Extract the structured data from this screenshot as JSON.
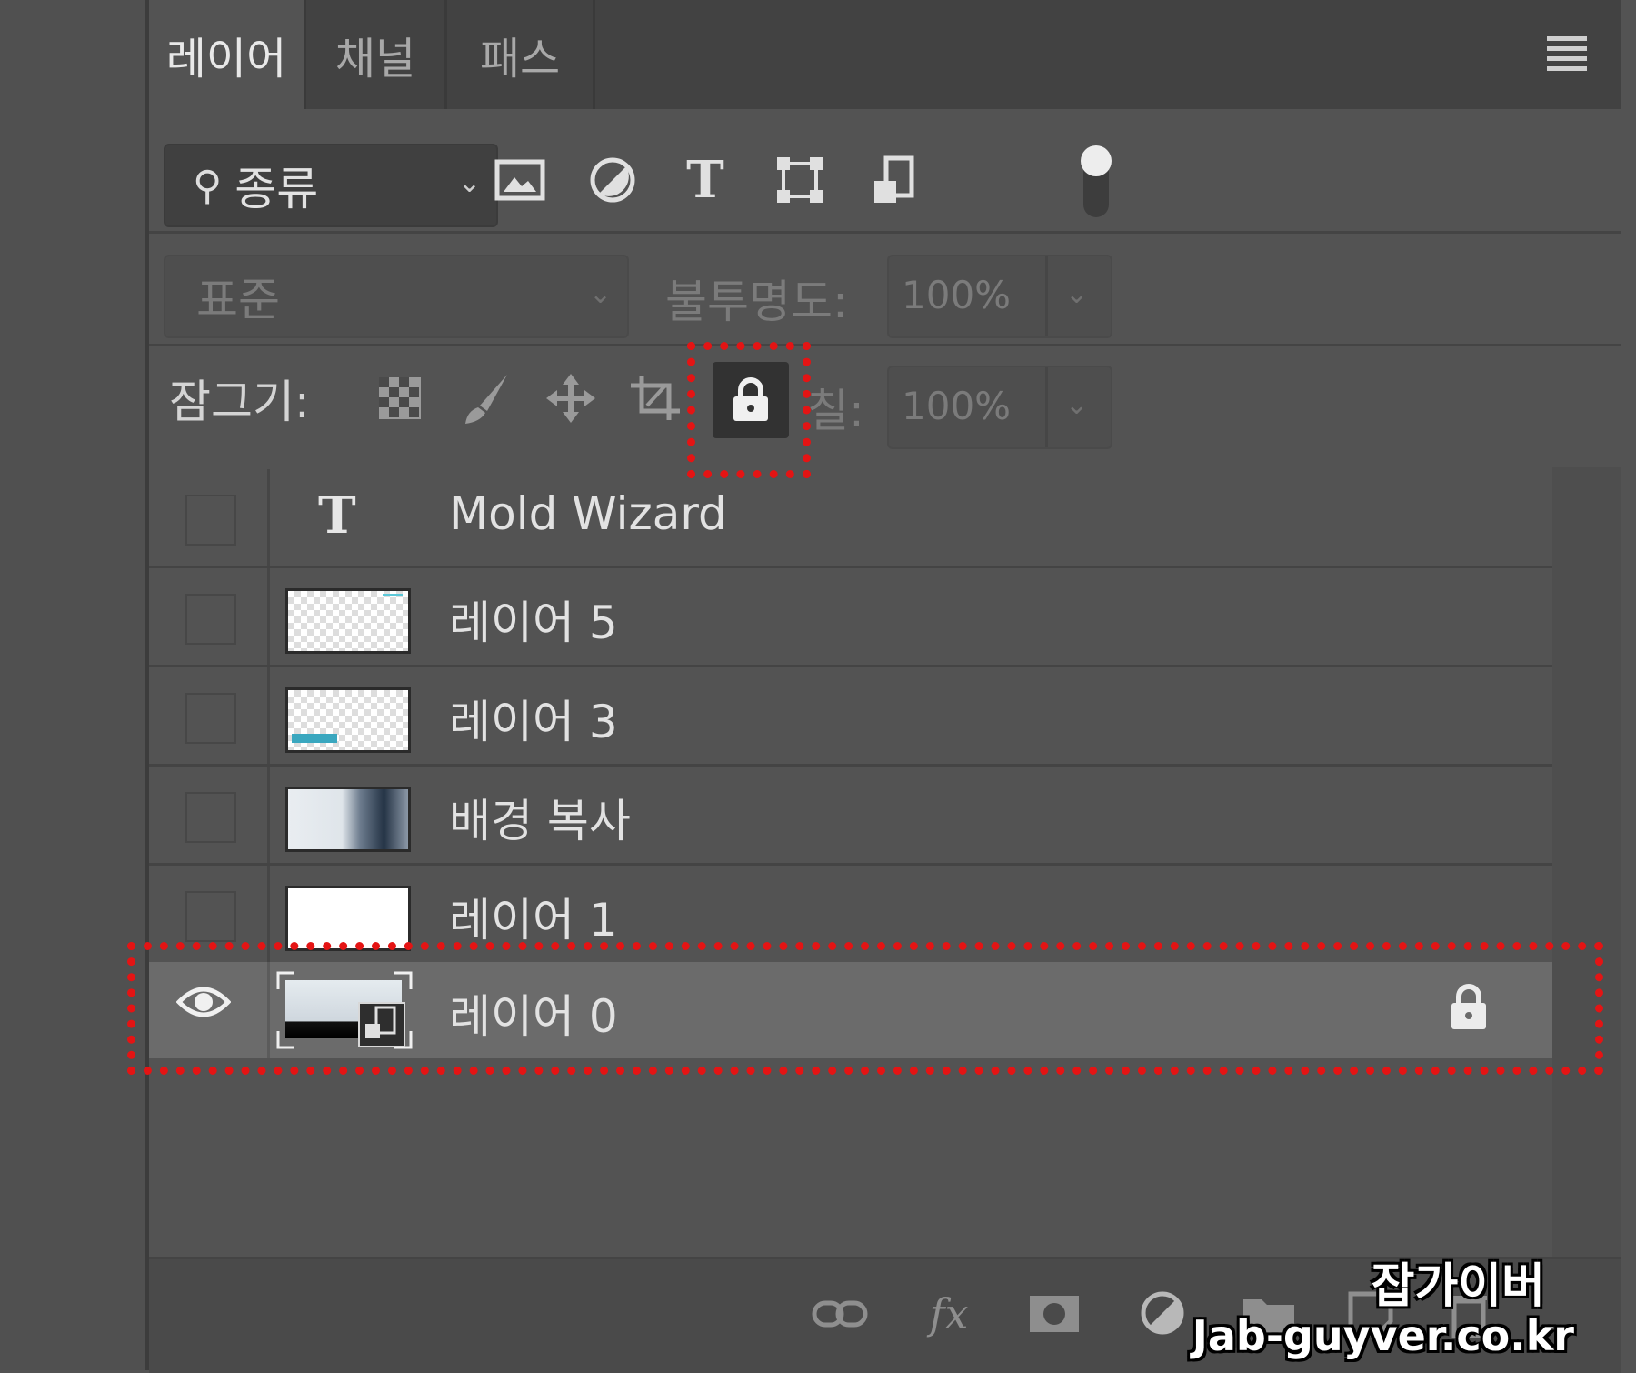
{
  "tabs": [
    {
      "label": "레이어",
      "active": true
    },
    {
      "label": "채널",
      "active": false
    },
    {
      "label": "패스",
      "active": false
    }
  ],
  "filter": {
    "kind_label": "종류"
  },
  "blend": {
    "mode": "표준",
    "opacity_label": "불투명도:",
    "opacity_value": "100%"
  },
  "lock": {
    "label": "잠그기:",
    "fill_label": "칠:",
    "fill_value": "100%"
  },
  "layers": [
    {
      "name": "Mold Wizard",
      "type": "text",
      "visible": false
    },
    {
      "name": "레이어 5",
      "type": "raster",
      "visible": false
    },
    {
      "name": "레이어 3",
      "type": "raster",
      "visible": false
    },
    {
      "name": "배경 복사",
      "type": "raster",
      "visible": false
    },
    {
      "name": "레이어 1",
      "type": "raster",
      "visible": false
    },
    {
      "name": "레이어 0",
      "type": "smart-object",
      "visible": true,
      "locked": true,
      "selected": true
    }
  ],
  "colors": {
    "panel_bg": "#535353",
    "selected_row": "#6b6b6b",
    "highlight": "#e41414"
  },
  "watermark": {
    "line1": "잡가이버",
    "line2": "Jab-guyver.co.kr"
  }
}
